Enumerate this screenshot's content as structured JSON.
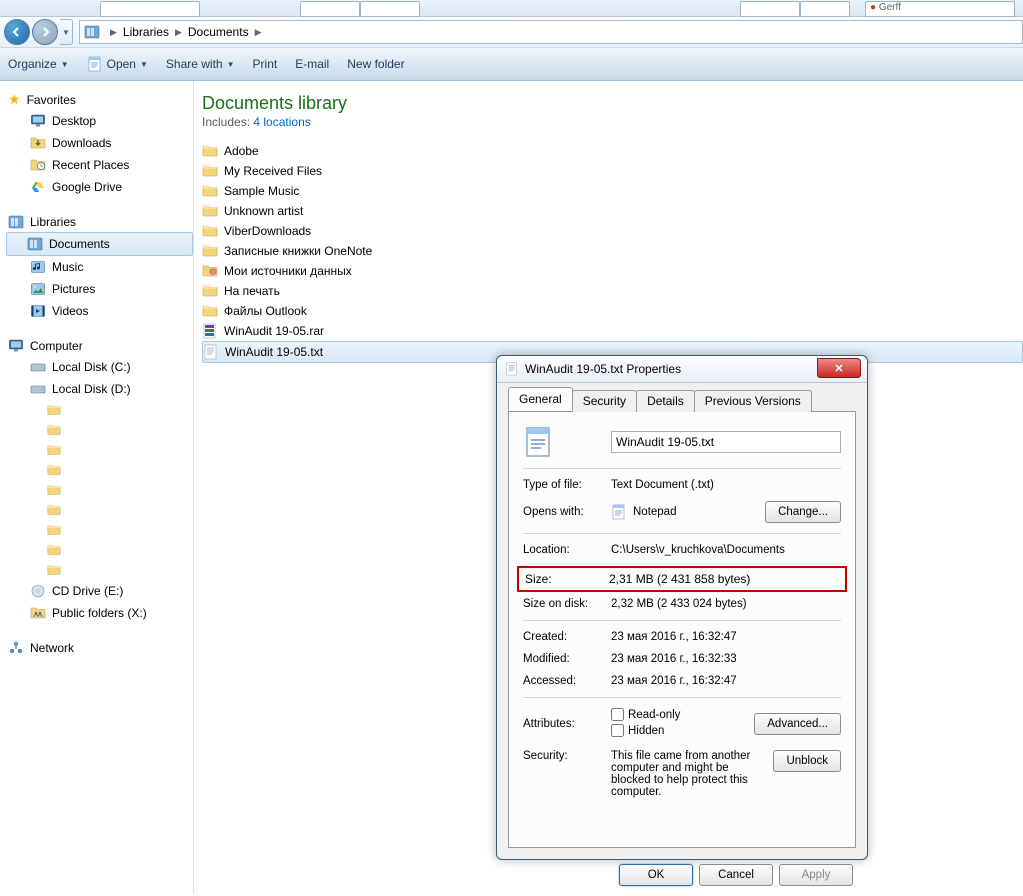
{
  "taskbar": {
    "right_tab": "Gerff"
  },
  "breadcrumb": {
    "root": "Libraries",
    "folder": "Documents"
  },
  "toolbar": {
    "organize": "Organize",
    "open": "Open",
    "share": "Share with",
    "print": "Print",
    "email": "E-mail",
    "newfolder": "New folder"
  },
  "sidebar": {
    "favorites": "Favorites",
    "fav_items": [
      "Desktop",
      "Downloads",
      "Recent Places",
      "Google Drive"
    ],
    "libraries": "Libraries",
    "lib_items": [
      "Documents",
      "Music",
      "Pictures",
      "Videos"
    ],
    "computer": "Computer",
    "comp_items": [
      "Local Disk (C:)",
      "Local Disk (D:)",
      "CD Drive (E:)",
      "Public folders (X:)"
    ],
    "network": "Network"
  },
  "library": {
    "title": "Documents library",
    "includes": "Includes:",
    "locations": "4 locations"
  },
  "files": [
    {
      "name": "Adobe",
      "type": "folder"
    },
    {
      "name": "My Received Files",
      "type": "folder"
    },
    {
      "name": "Sample Music",
      "type": "folder"
    },
    {
      "name": "Unknown artist",
      "type": "folder"
    },
    {
      "name": "ViberDownloads",
      "type": "folder"
    },
    {
      "name": "Записные книжки OneNote",
      "type": "folder"
    },
    {
      "name": "Мои источники данных",
      "type": "folder-db"
    },
    {
      "name": "На печать",
      "type": "folder"
    },
    {
      "name": "Файлы Outlook",
      "type": "folder"
    },
    {
      "name": "WinAudit 19-05.rar",
      "type": "rar"
    },
    {
      "name": "WinAudit 19-05.txt",
      "type": "txt",
      "selected": true
    }
  ],
  "dialog": {
    "title": "WinAudit 19-05.txt Properties",
    "tabs": [
      "General",
      "Security",
      "Details",
      "Previous Versions"
    ],
    "filename": "WinAudit 19-05.txt",
    "type_lbl": "Type of file:",
    "type_val": "Text Document (.txt)",
    "opens_lbl": "Opens with:",
    "opens_val": "Notepad",
    "change": "Change...",
    "loc_lbl": "Location:",
    "loc_val": "C:\\Users\\v_kruchkova\\Documents",
    "size_lbl": "Size:",
    "size_val": "2,31 MB (2 431 858 bytes)",
    "sod_lbl": "Size on disk:",
    "sod_val": "2,32 MB (2 433 024 bytes)",
    "cr_lbl": "Created:",
    "cr_val": "23 мая 2016 г., 16:32:47",
    "mo_lbl": "Modified:",
    "mo_val": "23 мая 2016 г., 16:32:33",
    "ac_lbl": "Accessed:",
    "ac_val": "23 мая 2016 г., 16:32:47",
    "attr_lbl": "Attributes:",
    "readonly": "Read-only",
    "hidden": "Hidden",
    "advanced": "Advanced...",
    "sec_lbl": "Security:",
    "sec_val": "This file came from another computer and might be blocked to help protect this computer.",
    "unblock": "Unblock",
    "ok": "OK",
    "cancel": "Cancel",
    "apply": "Apply"
  }
}
